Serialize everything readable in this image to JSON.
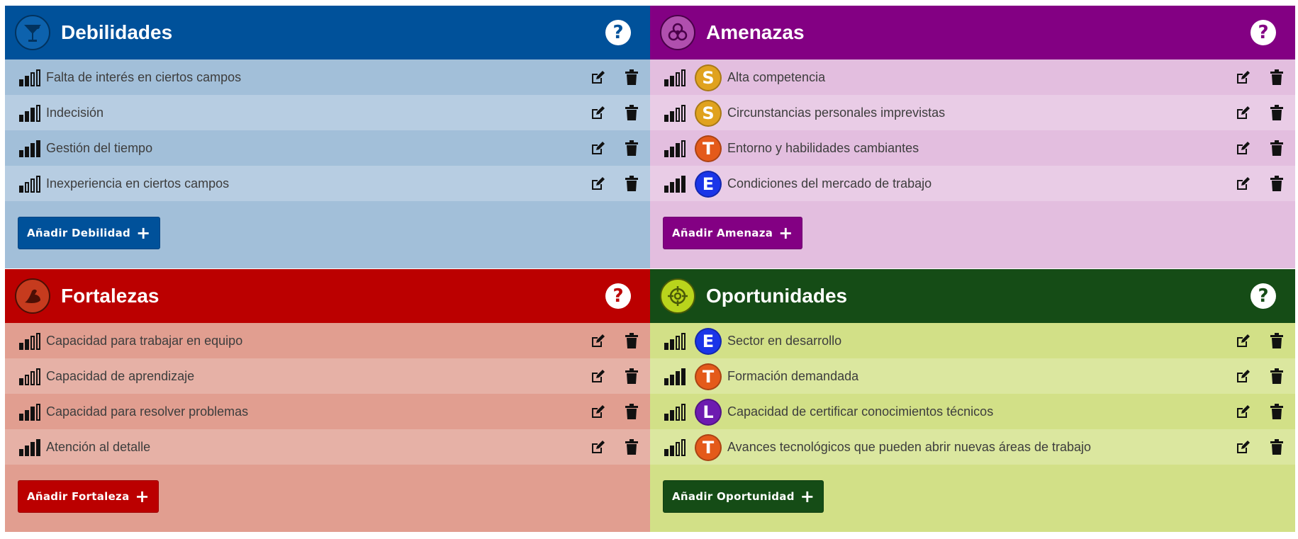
{
  "colors": {
    "weak_header": "#00519a",
    "weak_row_a": "#a2bfd9",
    "weak_row_b": "#b7cde2",
    "weak_bg": "#a2bfd9",
    "weak_help": "#00519a",
    "threat_header": "#830083",
    "threat_row_a": "#e3bedf",
    "threat_row_b": "#e9cce6",
    "threat_bg": "#e3bedf",
    "threat_help": "#830083",
    "strength_header": "#bb0000",
    "strength_row_a": "#e19e90",
    "strength_row_b": "#e6b1a6",
    "strength_bg": "#e19e90",
    "strength_help": "#bb0000",
    "opp_header": "#154c16",
    "opp_row_a": "#d2e087",
    "opp_row_b": "#dbe79f",
    "opp_bg": "#d2e087",
    "opp_help": "#154c16",
    "badge_S": "#e0a21e",
    "badge_T": "#e45a1a",
    "badge_E": "#1a35e8",
    "badge_L": "#6d1bb0"
  },
  "panels": [
    {
      "key": "weak",
      "title": "Debilidades",
      "emblem_icon": "cocktail-glass-icon",
      "add_label": "Añadir Debilidad",
      "items": [
        {
          "text": "Falta de interés en ciertos campos",
          "level": 2
        },
        {
          "text": "Indecisión",
          "level": 3
        },
        {
          "text": "Gestión del tiempo",
          "level": 4
        },
        {
          "text": "Inexperiencia en ciertos campos",
          "level": 1
        }
      ]
    },
    {
      "key": "threat",
      "title": "Amenazas",
      "emblem_icon": "biohazard-icon",
      "add_label": "Añadir Amenaza",
      "items": [
        {
          "text": "Alta competencia",
          "level": 2,
          "badge": "S"
        },
        {
          "text": "Circunstancias personales imprevistas",
          "level": 2,
          "badge": "S"
        },
        {
          "text": "Entorno y habilidades cambiantes",
          "level": 3,
          "badge": "T"
        },
        {
          "text": "Condiciones del mercado de trabajo",
          "level": 4,
          "badge": "E"
        }
      ]
    },
    {
      "key": "strength",
      "title": "Fortalezas",
      "emblem_icon": "flexed-arm-icon",
      "add_label": "Añadir Fortaleza",
      "items": [
        {
          "text": "Capacidad para trabajar en equipo",
          "level": 2
        },
        {
          "text": "Capacidad de aprendizaje",
          "level": 1
        },
        {
          "text": "Capacidad para resolver problemas",
          "level": 3
        },
        {
          "text": "Atención al detalle",
          "level": 4
        }
      ]
    },
    {
      "key": "opp",
      "title": "Oportunidades",
      "emblem_icon": "target-crosshair-icon",
      "add_label": "Añadir Oportunidad",
      "items": [
        {
          "text": "Sector en desarrollo",
          "level": 2,
          "badge": "E"
        },
        {
          "text": "Formación demandada",
          "level": 4,
          "badge": "T"
        },
        {
          "text": "Capacidad de certificar conocimientos técnicos",
          "level": 2,
          "badge": "L"
        },
        {
          "text": "Avances tecnológicos que pueden abrir nuevas áreas de trabajo",
          "level": 2,
          "badge": "T"
        }
      ]
    }
  ]
}
